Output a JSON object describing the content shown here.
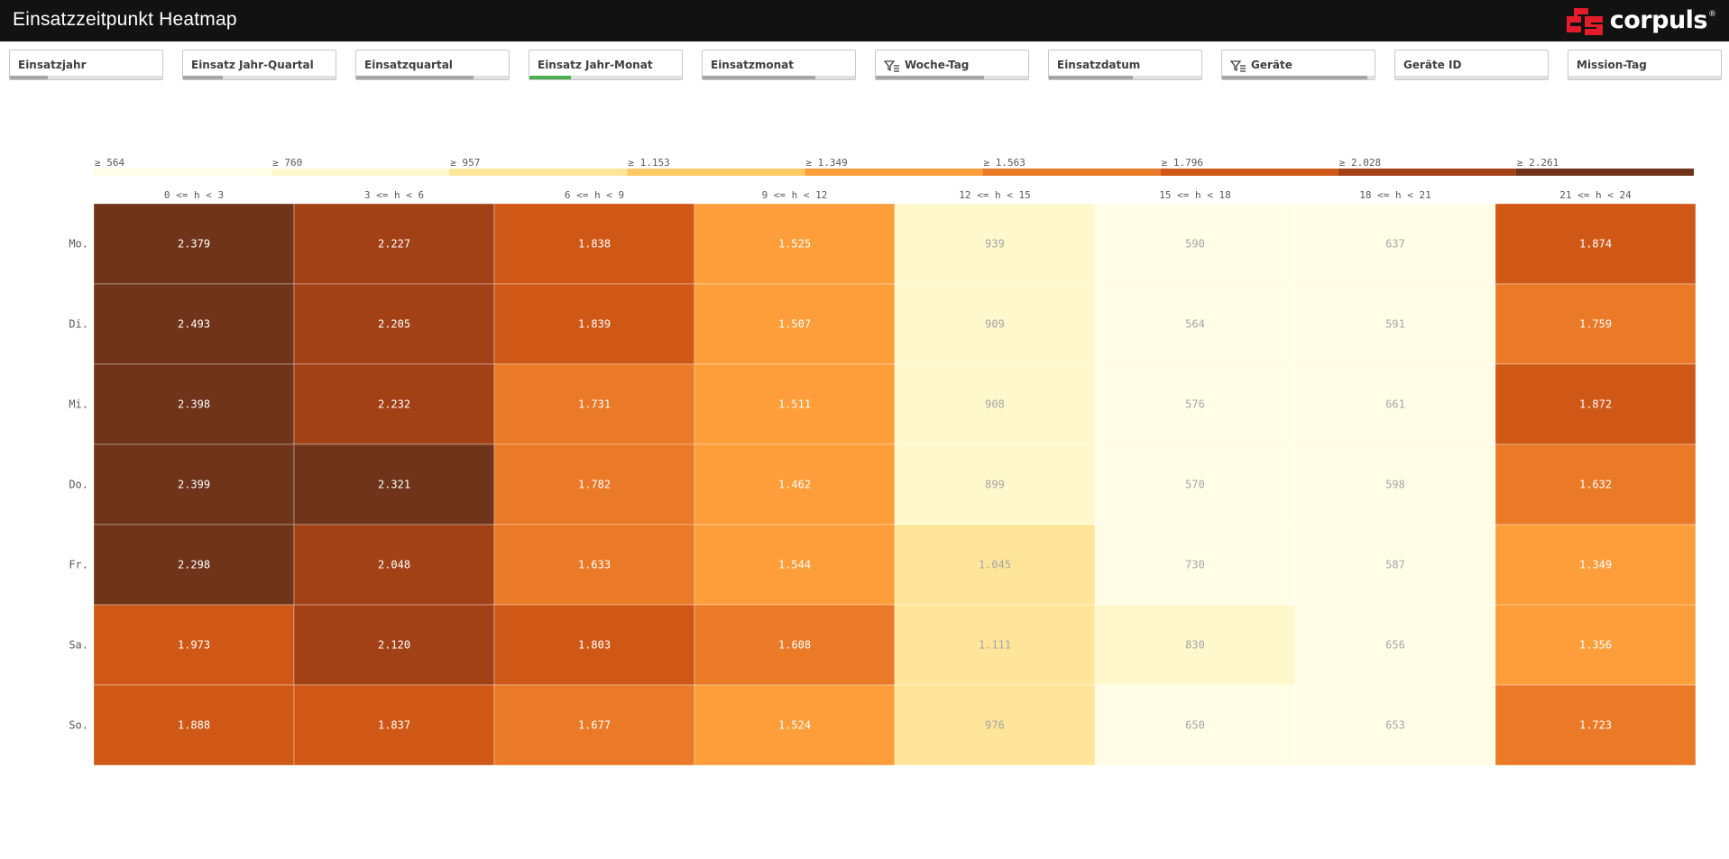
{
  "app": {
    "title": "Einsatzzeitpunkt Heatmap",
    "brand": "corpuls",
    "brand_mark": "®"
  },
  "colors": {
    "topbar": "#121212",
    "brand_red": "#e31b2a",
    "filter_fill_default": "#a6a6a6",
    "filter_fill_active": "#4caf50",
    "cell_text_dark": "#ffffff",
    "cell_text_light": "#a6a6a6"
  },
  "filters": [
    {
      "label": "Einsatzjahr",
      "icon": "",
      "fill": 0.25,
      "active": false
    },
    {
      "label": "Einsatz Jahr-Quartal",
      "icon": "",
      "fill": 0.26,
      "active": false
    },
    {
      "label": "Einsatzquartal",
      "icon": "",
      "fill": 0.77,
      "active": false
    },
    {
      "label": "Einsatz Jahr-Monat",
      "icon": "",
      "fill": 0.27,
      "active": true
    },
    {
      "label": "Einsatzmonat",
      "icon": "",
      "fill": 0.74,
      "active": false
    },
    {
      "label": "Woche-Tag",
      "icon": "drill-down-icon",
      "fill": 0.71,
      "active": false
    },
    {
      "label": "Einsatzdatum",
      "icon": "",
      "fill": 0.55,
      "active": false
    },
    {
      "label": "Geräte",
      "icon": "drill-down-icon",
      "fill": 0.95,
      "active": false
    },
    {
      "label": "Geräte ID",
      "icon": "",
      "fill": 0.0,
      "active": false
    },
    {
      "label": "Mission-Tag",
      "icon": "",
      "fill": 0.0,
      "active": false
    }
  ],
  "chart_data": {
    "type": "heatmap",
    "title": "",
    "x_categories": [
      "0 <= h < 3",
      "3 <= h < 6",
      "6 <= h < 9",
      "9 <= h < 12",
      "12 <= h < 15",
      "15 <= h < 18",
      "18 <= h < 21",
      "21 <= h < 24"
    ],
    "y_categories": [
      "Mo.",
      "Di.",
      "Mi.",
      "Do.",
      "Fr.",
      "Sa.",
      "So."
    ],
    "values": [
      [
        2379,
        2227,
        1838,
        1525,
        939,
        590,
        637,
        1874
      ],
      [
        2493,
        2205,
        1839,
        1507,
        909,
        564,
        591,
        1759
      ],
      [
        2398,
        2232,
        1731,
        1511,
        908,
        576,
        661,
        1872
      ],
      [
        2399,
        2321,
        1782,
        1462,
        899,
        570,
        598,
        1632
      ],
      [
        2298,
        2048,
        1633,
        1544,
        1045,
        730,
        587,
        1349
      ],
      [
        1973,
        2120,
        1803,
        1608,
        1111,
        830,
        656,
        1356
      ],
      [
        1888,
        1837,
        1677,
        1524,
        976,
        650,
        653,
        1723
      ]
    ],
    "labels": [
      [
        "2.379",
        "2.227",
        "1.838",
        "1.525",
        "939",
        "590",
        "637",
        "1.874"
      ],
      [
        "2.493",
        "2.205",
        "1.839",
        "1.507",
        "909",
        "564",
        "591",
        "1.759"
      ],
      [
        "2.398",
        "2.232",
        "1.731",
        "1.511",
        "908",
        "576",
        "661",
        "1.872"
      ],
      [
        "2.399",
        "2.321",
        "1.782",
        "1.462",
        "899",
        "570",
        "598",
        "1.632"
      ],
      [
        "2.298",
        "2.048",
        "1.633",
        "1.544",
        "1.045",
        "730",
        "587",
        "1.349"
      ],
      [
        "1.973",
        "2.120",
        "1.803",
        "1.608",
        "1.111",
        "830",
        "656",
        "1.356"
      ],
      [
        "1.888",
        "1.837",
        "1.677",
        "1.524",
        "976",
        "650",
        "653",
        "1.723"
      ]
    ],
    "legend": {
      "placement": "top",
      "thresholds": [
        564,
        760,
        957,
        1153,
        1349,
        1563,
        1796,
        2028,
        2261
      ],
      "labels": [
        "≥ 564",
        "≥ 760",
        "≥ 957",
        "≥ 1.153",
        "≥ 1.349",
        "≥ 1.563",
        "≥ 1.796",
        "≥ 2.028",
        "≥ 2.261"
      ],
      "colors": [
        "#fffde6",
        "#fff8cc",
        "#fee59a",
        "#fec964",
        "#fd9e3a",
        "#ea7a27",
        "#d05816",
        "#a34116",
        "#6f3419"
      ]
    },
    "grid": false
  }
}
